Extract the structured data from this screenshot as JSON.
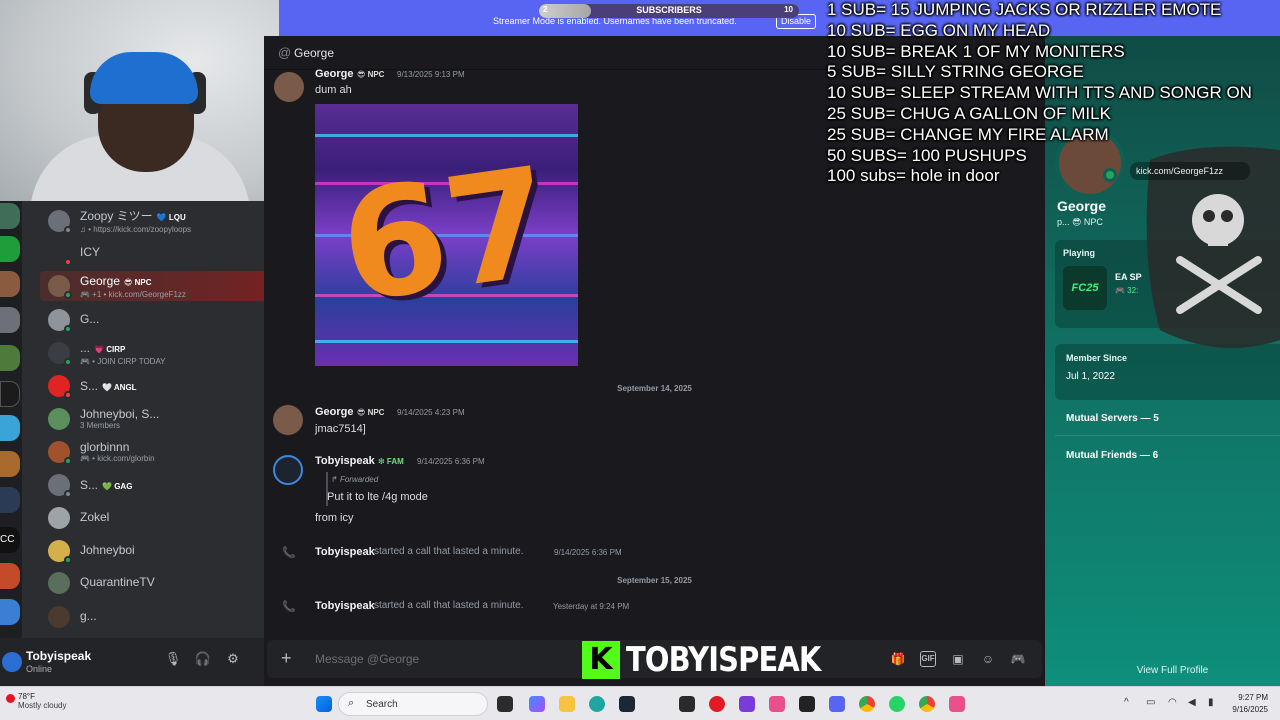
{
  "webcam": {},
  "banner": {
    "message": "Streamer Mode is enabled. Usernames have been truncated.",
    "disable_label": "Disable",
    "sub_goal": {
      "label": "SUBSCRIBERS",
      "current": "2",
      "target": "10",
      "progress": 0.2
    }
  },
  "sub_overlay": [
    "1 SUB= 15 JUMPING JACKS OR RIZZLER EMOTE",
    "10 SUB= EGG ON MY HEAD",
    "10 SUB= BREAK 1 OF MY MONITERS",
    "5 SUB= SILLY STRING GEORGE",
    "10 SUB= SLEEP STREAM WITH TTS AND SONGR ON",
    "25 SUB= CHUG A GALLON OF MILK",
    "25 SUB= CHANGE MY FIRE ALARM",
    "50 SUBS= 100 PUSHUPS",
    "100 subs= hole in door"
  ],
  "dm_list": [
    {
      "name": "Zoopy ミツー",
      "tag": "💙 LQU",
      "sub": "♫ • https://kick.com/zoopyloops",
      "avatar_color": "#6b6f78",
      "status_color": "#80848e",
      "active": false
    },
    {
      "name": "ICY",
      "tag": "",
      "sub": "",
      "avatar_color": "#2b2d31",
      "status_color": "#f23f43",
      "active": false
    },
    {
      "name": "George",
      "tag": "😎 NPC",
      "sub": "🎮 +1 • kick.com/GeorgeF1zz",
      "avatar_color": "#7a5a48",
      "status_color": "#23a55a",
      "active": true
    },
    {
      "name": "G...",
      "tag": "",
      "sub": "",
      "avatar_color": "#8f949c",
      "status_color": "#23a55a",
      "active": false
    },
    {
      "name": "...",
      "tag": "💗 CIRP",
      "sub": "🎮 • JOIN CIRP TODAY",
      "avatar_color": "#3a3d44",
      "status_color": "#23a55a",
      "active": false
    },
    {
      "name": "S...",
      "tag": "🤍 ANGL",
      "sub": "",
      "avatar_color": "#e02424",
      "status_color": "#f23f43",
      "active": false
    },
    {
      "name": "Johneyboi, S...",
      "tag": "",
      "sub": "3 Members",
      "avatar_color": "#5b8f5e",
      "status_color": "",
      "active": false
    },
    {
      "name": "glorbinnn",
      "tag": "",
      "sub": "🎮 • kick.com/glorbin",
      "avatar_color": "#a0522d",
      "status_color": "#23a55a",
      "active": false
    },
    {
      "name": "S...",
      "tag": "💚 GAG",
      "sub": "",
      "avatar_color": "#6b6f78",
      "status_color": "#80848e",
      "active": false
    },
    {
      "name": "Zokel",
      "tag": "",
      "sub": "",
      "avatar_color": "#9ea3a8",
      "status_color": "",
      "active": false
    },
    {
      "name": "Johneyboi",
      "tag": "",
      "sub": "",
      "avatar_color": "#d4b04a",
      "status_color": "#23a55a",
      "active": false
    },
    {
      "name": "QuarantineTV",
      "tag": "",
      "sub": "",
      "avatar_color": "#5a6e5c",
      "status_color": "",
      "active": false
    },
    {
      "name": "g...",
      "tag": "",
      "sub": "",
      "avatar_color": "#4a3a30",
      "status_color": "",
      "active": false
    }
  ],
  "user_panel": {
    "name": "Tobyispeak",
    "status": "Online"
  },
  "chat": {
    "header_title": "George",
    "msg1": {
      "name": "George",
      "tag": "😎 NPC",
      "time": "9/13/2025 9:13 PM",
      "text": "dum ah"
    },
    "image_text": "67",
    "date1": "September 14, 2025",
    "msg2": {
      "name": "George",
      "tag": "😎 NPC",
      "time": "9/14/2025 4:23 PM",
      "text": "jmac7514]"
    },
    "msg3": {
      "name": "Tobyispeak",
      "tag": "❇ FAM",
      "time": "9/14/2025 6:36 PM",
      "forwarded": "Forwarded",
      "fwd_text": "Put it to lte /4g mode",
      "text": "from icy"
    },
    "call1": {
      "name": "Tobyispeak",
      "text": "started a call that lasted a minute.",
      "time": "9/14/2025 6:36 PM"
    },
    "date2": "September 15, 2025",
    "call2": {
      "name": "Tobyispeak",
      "text": "started a call that lasted a minute.",
      "time": "Yesterday at 9:24 PM"
    },
    "composer_placeholder": "Message @George"
  },
  "profile": {
    "name": "George",
    "sub": "p...  😎 NPC",
    "kick_link": "kick.com/GeorgeF1zz",
    "playing_label": "Playing",
    "game_badge": "FC25",
    "game_name": "EA SP",
    "game_meta": "🎮 32:",
    "member_since_label": "Member Since",
    "member_since_value": "Jul 1, 2022",
    "mutual_servers": "Mutual Servers — 5",
    "mutual_friends": "Mutual Friends — 6",
    "view_full": "View Full Profile"
  },
  "watermark": {
    "k": "K",
    "text": "TOBYISPEAK"
  },
  "taskbar": {
    "temp": "78°F",
    "condition": "Mostly cloudy",
    "search_placeholder": "Search",
    "time": "9:27 PM",
    "date": "9/16/2025"
  },
  "colors": {
    "blurple": "#5865f2",
    "profile_teal": "#116a5e",
    "kick_green": "#53fc18"
  }
}
